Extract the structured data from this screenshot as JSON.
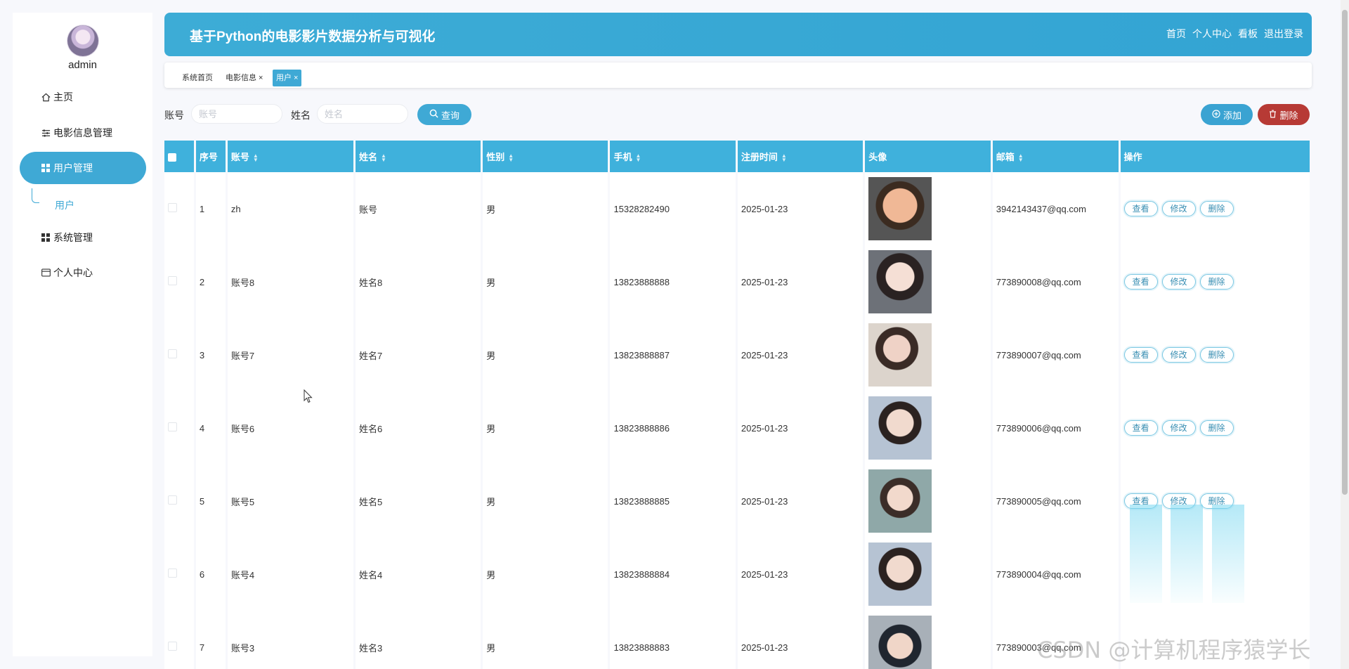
{
  "sidebar": {
    "user_name": "admin",
    "menu": [
      {
        "label": "主页",
        "icon": "home-icon"
      },
      {
        "label": "电影信息管理",
        "icon": "sliders-icon"
      },
      {
        "label": "用户管理",
        "icon": "grid-icon",
        "active": true
      },
      {
        "label": "系统管理",
        "icon": "grid-icon"
      },
      {
        "label": "个人中心",
        "icon": "card-icon"
      }
    ],
    "sub_item": "用户"
  },
  "header": {
    "title": "基于Python的电影影片数据分析与可视化",
    "nav": [
      "首页",
      "个人中心",
      "看板",
      "退出登录"
    ]
  },
  "tabs": [
    "系统首页",
    "电影信息 ×",
    "用户 ×"
  ],
  "search": {
    "account_label": "账号",
    "account_placeholder": "账号",
    "name_label": "姓名",
    "name_placeholder": "姓名",
    "search_button": "查询",
    "add_button": "添加",
    "delete_button": "删除"
  },
  "table": {
    "columns": [
      "序号",
      "账号",
      "姓名",
      "性别",
      "手机",
      "注册时间",
      "头像",
      "邮箱",
      "操作"
    ],
    "action_labels": [
      "查看",
      "修改",
      "删除"
    ],
    "rows": [
      {
        "no": "1",
        "account": "zh",
        "name": "账号",
        "gender": "男",
        "phone": "15328282490",
        "date": "2025-01-23",
        "email": "3942143437@qq.com"
      },
      {
        "no": "2",
        "account": "账号8",
        "name": "姓名8",
        "gender": "男",
        "phone": "13823888888",
        "date": "2025-01-23",
        "email": "773890008@qq.com"
      },
      {
        "no": "3",
        "account": "账号7",
        "name": "姓名7",
        "gender": "男",
        "phone": "13823888887",
        "date": "2025-01-23",
        "email": "773890007@qq.com"
      },
      {
        "no": "4",
        "account": "账号6",
        "name": "姓名6",
        "gender": "男",
        "phone": "13823888886",
        "date": "2025-01-23",
        "email": "773890006@qq.com"
      },
      {
        "no": "5",
        "account": "账号5",
        "name": "姓名5",
        "gender": "男",
        "phone": "13823888885",
        "date": "2025-01-23",
        "email": "773890005@qq.com"
      },
      {
        "no": "6",
        "account": "账号4",
        "name": "姓名4",
        "gender": "男",
        "phone": "13823888884",
        "date": "2025-01-23",
        "email": "773890004@qq.com"
      },
      {
        "no": "7",
        "account": "账号3",
        "name": "姓名3",
        "gender": "男",
        "phone": "13823888883",
        "date": "2025-01-23",
        "email": "773890003@qq.com"
      }
    ]
  },
  "watermark": "CSDN @计算机程序猿学长",
  "colors": {
    "primary": "#3fa9d5",
    "danger": "#b73a35",
    "header": "#3fb1dc"
  }
}
